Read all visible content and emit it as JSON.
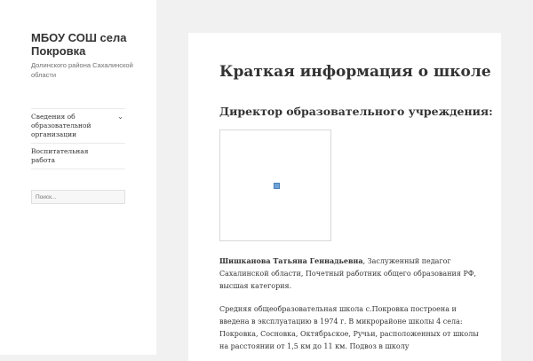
{
  "site": {
    "title": "МБОУ СОШ села Покровка",
    "description": "Долинского района Сахалинской области"
  },
  "menu": {
    "items": [
      {
        "label": "Сведения об образовательной организации",
        "has_submenu": true
      },
      {
        "label": "Воспитательная работа",
        "has_submenu": false
      }
    ]
  },
  "search": {
    "placeholder": "Поиск..."
  },
  "article": {
    "title": "Краткая информация о школе",
    "subtitle": "Директор образовательного учреждения:",
    "director_name": "Шишканова Татьяна Геннадьевна",
    "director_info": ", Заслуженный педагог Сахалинской области, Почетный работник общего образования РФ, высшая категория.",
    "paragraph": "Средняя общеобразовательная школа с.Покровка построена и введена в эксплуатацию в 1974 г. В микрорайоне школы 4 села: Покровка, Сосновка, Октябрьское, Ручьи, расположенных от школы на расстоянии от 1,5 км до 11 км. Подвоз в школу"
  },
  "icons": {
    "chevron": "chevron-down-icon",
    "image": "broken-image-icon"
  }
}
